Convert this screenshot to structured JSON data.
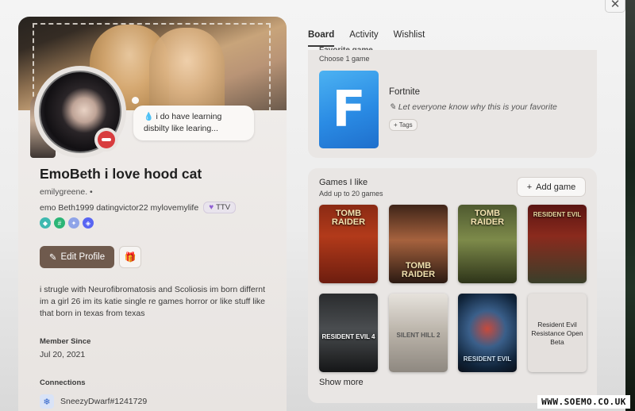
{
  "window": {
    "close_glyph": "✕"
  },
  "profile": {
    "status_text": "i do have learning disbilty like learing...",
    "status_icon": "blood-drop-icon",
    "status": "dnd",
    "display_name": "EmoBeth i love hood cat",
    "username": "emilygreene.",
    "pronouns": "emo Beth1999 datingvictor22 mylovemylife",
    "ttv_label": "TTV",
    "edit_label": "Edit Profile",
    "bio": "i strugle with Neurofibromatosis  and Scoliosis im born differnt im a girl 26 im  its katie single  re games horror or like stuff like that born in texas from texas",
    "member_since_label": "Member Since",
    "member_since": "Jul 20, 2021",
    "connections_label": "Connections",
    "connection_name": "SneezyDwarf#1241729",
    "badge_colors": [
      "#3fb9b0",
      "#2bb576",
      "#8fa4e8",
      "#5865f2"
    ]
  },
  "tabs": [
    "Board",
    "Activity",
    "Wishlist"
  ],
  "favorite": {
    "title": "Favorite game",
    "subtitle": "Choose 1 game",
    "name": "Fortnite",
    "reason": "Let everyone know why this is your favorite",
    "tags_label": "+ Tags",
    "cover_letter": "F"
  },
  "games": {
    "title": "Games I like",
    "subtitle": "Add up to 20 games",
    "add_label": "Add game",
    "show_more": "Show more",
    "items": [
      {
        "label": "TOMB RAIDER",
        "bg": "linear-gradient(180deg,#8a2a14 0%,#b23a1a 40%,#6d1d0f 100%)"
      },
      {
        "label": "TOMB RAIDER",
        "bg": "linear-gradient(180deg,#3e2418 0%,#a6623e 45%,#2b1a12 100%)"
      },
      {
        "label": "TOMB RAIDER",
        "bg": "linear-gradient(180deg,#4f5a30 0%,#7d8a4a 45%,#2e3419 100%)"
      },
      {
        "label": "RESIDENT EVIL",
        "bg": "linear-gradient(180deg,#5a1512 0%,#8a2a1d 40%,#3a3f2a 100%)"
      },
      {
        "label": "RESIDENT EVIL 4",
        "bg": "linear-gradient(180deg,#2a2c2e 0%,#4a4d50 45%,#151617 100%)"
      },
      {
        "label": "SILENT HILL 2",
        "bg": "linear-gradient(180deg,#e6e2dc 0%,#b9b2a8 50%,#8e8880 100%)"
      },
      {
        "label": "RESIDENT EVIL",
        "bg": "radial-gradient(circle at 50% 45%,#c74a3c 0%,#3a5f8a 35%,#10243a 75%,#0a0f18 100%)"
      },
      {
        "label": "Resident Evil Resistance Open Beta",
        "bg": "#e4e0dd"
      }
    ]
  },
  "watermark": "WWW.SOEMO.CO.UK"
}
